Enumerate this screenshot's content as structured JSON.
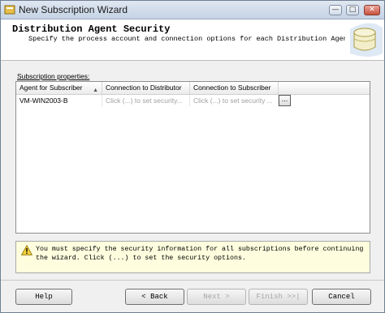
{
  "window": {
    "title": "New Subscription Wizard",
    "controls": {
      "minimize": "—",
      "maximize": "□",
      "close": "✕"
    }
  },
  "header": {
    "title": "Distribution Agent Security",
    "subtitle": "Specify the process account and connection options for each Distribution Agent.",
    "graphic_icon": "wizard-database-icon"
  },
  "grid": {
    "label": "Subscription properties:",
    "columns": [
      "Agent for Subscriber",
      "Connection to Distributor",
      "Connection to Subscriber"
    ],
    "sort_indicator": "▲",
    "rows": [
      {
        "subscriber": "VM-WIN2003-B",
        "distributor_conn": "Click (...) to set security...",
        "subscriber_conn": "Click (...) to set security ...",
        "button": "..."
      }
    ]
  },
  "warning": {
    "icon": "warning-triangle-icon",
    "text": "You must specify the security information for all subscriptions before continuing the wizard. Click (...) to set the security options."
  },
  "buttons": {
    "help": "Help",
    "back": "< Back",
    "next": "Next >",
    "finish": "Finish >>|",
    "cancel": "Cancel"
  },
  "colors": {
    "warning_bg": "#fefedf",
    "title_bar": "#c5d3e4",
    "close_button": "#c7513f"
  }
}
